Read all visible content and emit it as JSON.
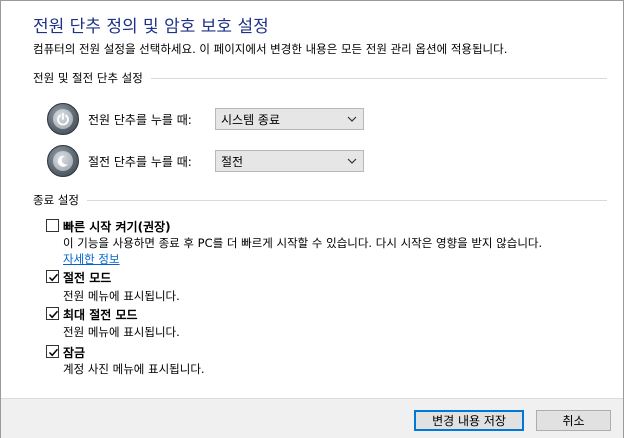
{
  "page": {
    "title": "전원 단추 정의 및 암호 보호 설정",
    "description": "컴퓨터의 전원 설정을 선택하세요. 이 페이지에서 변경한 내용은 모든 전원 관리 옵션에 적용됩니다."
  },
  "power_section": {
    "header": "전원 및 절전 단추 설정",
    "rows": [
      {
        "label": "전원 단추를 누를 때:",
        "value": "시스템 종료",
        "icon": "power-button-icon"
      },
      {
        "label": "절전 단추를 누를 때:",
        "value": "절전",
        "icon": "sleep-button-icon"
      }
    ]
  },
  "shutdown_section": {
    "header": "종료 설정",
    "items": [
      {
        "title": "빠른 시작 켜기(권장)",
        "desc": "이 기능을 사용하면 종료 후 PC를 더 빠르게 시작할 수 있습니다. 다시 시작은 영향을 받지 않습니다.",
        "link": "자세한 정보",
        "checked": false
      },
      {
        "title": "절전 모드",
        "desc": "전원 메뉴에 표시됩니다.",
        "checked": true
      },
      {
        "title": "최대 절전 모드",
        "desc": "전원 메뉴에 표시됩니다.",
        "checked": true
      },
      {
        "title": "잠금",
        "desc": "계정 사진 메뉴에 표시됩니다.",
        "checked": true
      }
    ]
  },
  "footer": {
    "save_label": "변경 내용 저장",
    "cancel_label": "취소"
  },
  "colors": {
    "title": "#1e3287",
    "link": "#0066cc",
    "primary_border": "#0078d7"
  }
}
